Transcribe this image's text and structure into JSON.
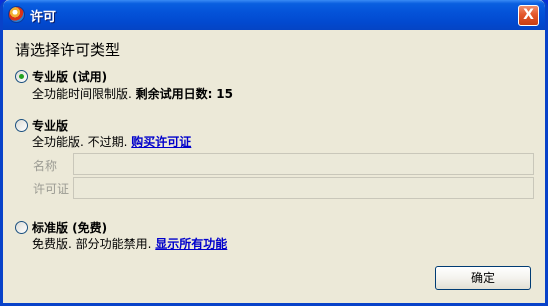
{
  "window": {
    "title": "许可",
    "close_glyph": "X"
  },
  "dialog": {
    "heading": "请选择许可类型",
    "options": [
      {
        "title": "专业版 (试用)",
        "desc": "全功能时间限制版.",
        "remaining_label": "剩余试用日数:",
        "remaining_days": "15",
        "selected": true
      },
      {
        "title": "专业版",
        "desc": "全功能版. 不过期.",
        "link": "购买许可证",
        "selected": false
      },
      {
        "title": "标准版 (免费)",
        "desc": "免费版. 部分功能禁用.",
        "link": "显示所有功能",
        "selected": false
      }
    ],
    "fields": {
      "name_label": "名称",
      "name_value": "",
      "license_label": "许可证",
      "license_value": ""
    },
    "ok_label": "确定"
  },
  "colors": {
    "titlebar": "#0453d9",
    "window_bg": "#ece9d8",
    "link": "#0000cc",
    "radio_selected": "#21a121"
  },
  "icons": {
    "app": "app-logo-icon",
    "close": "close-icon"
  }
}
